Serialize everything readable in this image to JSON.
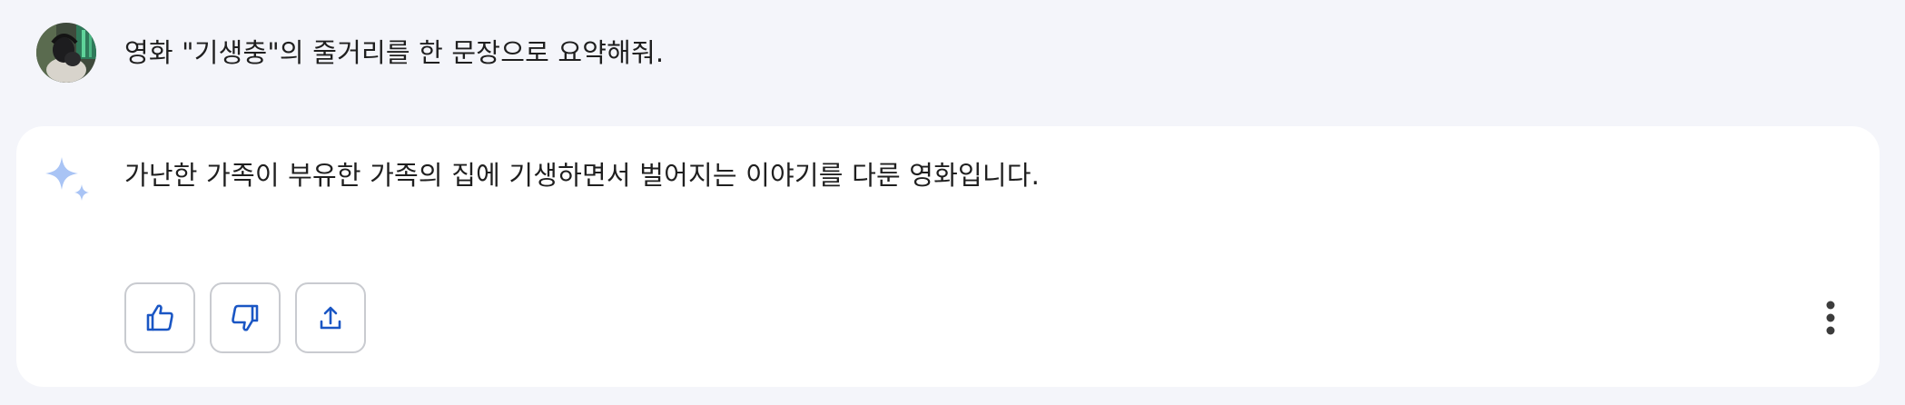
{
  "conversation": {
    "user_message": "영화 \"기생충\"의 줄거리를 한 문장으로 요약해줘.",
    "assistant_response": "가난한 가족이 부유한 가족의 집에 기생하면서 벌어지는 이야기를 다룬 영화입니다."
  },
  "actions": {
    "icons": [
      "thumbs-up-icon",
      "thumbs-down-icon",
      "share-icon",
      "more-vert-icon"
    ]
  },
  "colors": {
    "page_background": "#f4f5fa",
    "card_background": "#ffffff",
    "icon_accent": "#1a56c4",
    "sparkle": "#a9c4f5",
    "button_border": "#c9cbd0"
  }
}
